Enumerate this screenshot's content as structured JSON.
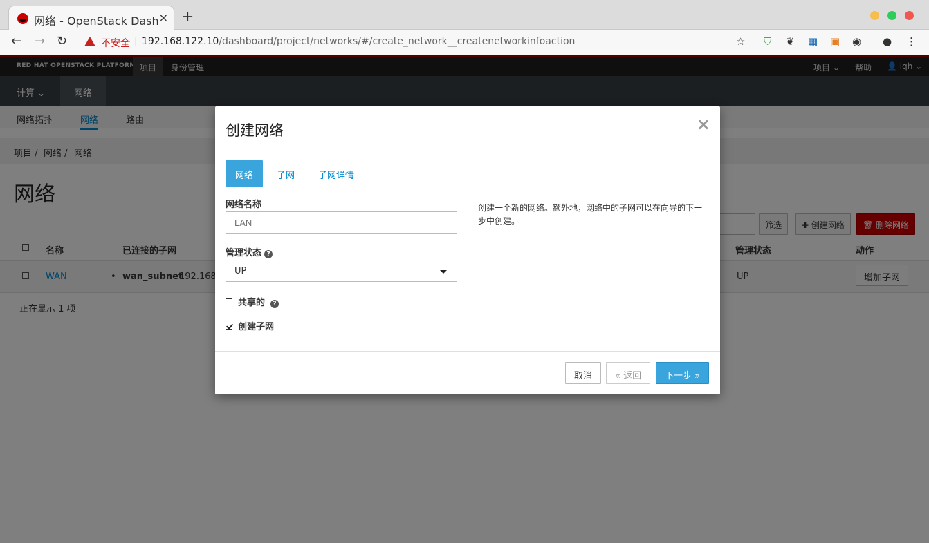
{
  "browser": {
    "tab_title": "网络 - OpenStack Dashbo",
    "tab_close": "×",
    "new_tab": "+",
    "insecure_label": "不安全",
    "url_host": "192.168.122.10",
    "url_path": "/dashboard/project/networks/#/create_network__createnetworkinfoaction"
  },
  "masthead": {
    "brand": "RED HAT OPENSTACK PLATFORM",
    "nav": [
      "项目",
      "身份管理"
    ],
    "right": [
      "项目 ⌄",
      "帮助",
      "👤 lqh ⌄"
    ]
  },
  "nav2": {
    "items": [
      "计算 ⌄",
      "网络"
    ]
  },
  "subnav": {
    "items": [
      "网络拓扑",
      "网络",
      "路由"
    ]
  },
  "breadcrumb": [
    "项目 /",
    "网络 /",
    "网络"
  ],
  "page_title": "网络",
  "toolbar": {
    "filter": "筛选",
    "create": "✚ 创建网络",
    "delete": "🗑 删除网络"
  },
  "table": {
    "headers": [
      "名称",
      "已连接的子网",
      "管理状态",
      "动作"
    ],
    "row": {
      "name": "WAN",
      "subnet_name": "wan_subnet",
      "subnet_ip": "192.168.",
      "admin_state": "UP",
      "action": "增加子网"
    },
    "count": "正在显示 1 项"
  },
  "modal": {
    "title": "创建网络",
    "close": "×",
    "tabs": [
      "网络",
      "子网",
      "子网详情"
    ],
    "network_name_label": "网络名称",
    "network_name_placeholder": "LAN",
    "admin_state_label": "管理状态",
    "admin_state_value": "UP",
    "shared_label": "共享的",
    "create_subnet_label": "创建子网",
    "help_text": "创建一个新的网络。额外地，网络中的子网可以在向导的下一步中创建。",
    "cancel": "取消",
    "back": "« 返回",
    "next": "下一步 »"
  }
}
